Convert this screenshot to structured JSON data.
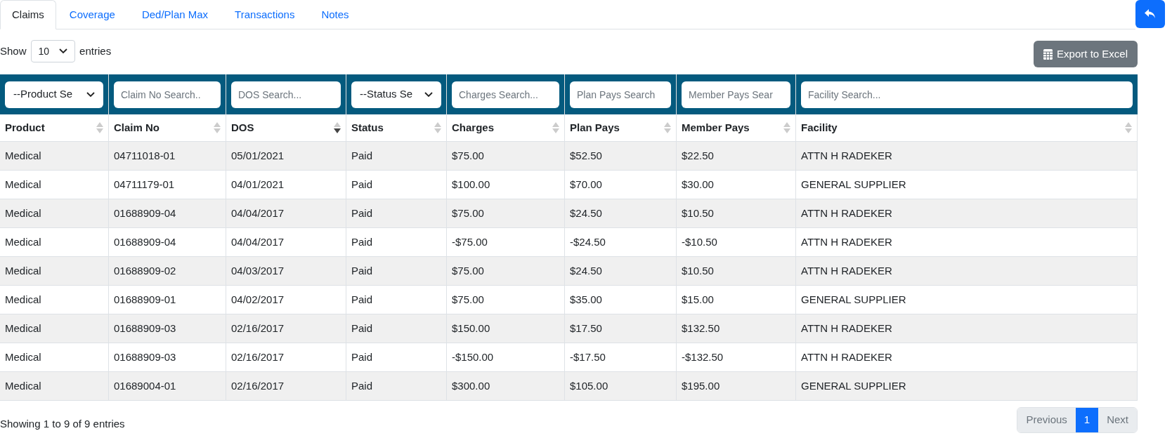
{
  "tabs": [
    {
      "label": "Claims",
      "selected": true
    },
    {
      "label": "Coverage",
      "selected": false
    },
    {
      "label": "Ded/Plan Max",
      "selected": false
    },
    {
      "label": "Transactions",
      "selected": false
    },
    {
      "label": "Notes",
      "selected": false
    }
  ],
  "length_control": {
    "prefix": "Show",
    "value": "10",
    "suffix": "entries"
  },
  "export_button": "Export to Excel",
  "filters": [
    {
      "kind": "select",
      "value": "--Product Se"
    },
    {
      "kind": "input",
      "placeholder": "Claim No Search.."
    },
    {
      "kind": "input",
      "placeholder": "DOS Search..."
    },
    {
      "kind": "select",
      "value": "--Status Se"
    },
    {
      "kind": "input",
      "placeholder": "Charges Search..."
    },
    {
      "kind": "input",
      "placeholder": "Plan Pays Search"
    },
    {
      "kind": "input",
      "placeholder": "Member Pays Sear"
    },
    {
      "kind": "input",
      "placeholder": "Facility Search..."
    }
  ],
  "columns": [
    {
      "label": "Product",
      "sorted": false
    },
    {
      "label": "Claim No",
      "sorted": false
    },
    {
      "label": "DOS",
      "sorted": true
    },
    {
      "label": "Status",
      "sorted": false
    },
    {
      "label": "Charges",
      "sorted": false
    },
    {
      "label": "Plan Pays",
      "sorted": false
    },
    {
      "label": "Member Pays",
      "sorted": false
    },
    {
      "label": "Facility",
      "sorted": false
    }
  ],
  "rows": [
    [
      "Medical",
      "04711018-01",
      "05/01/2021",
      "Paid",
      "$75.00",
      "$52.50",
      "$22.50",
      "ATTN H RADEKER"
    ],
    [
      "Medical",
      "04711179-01",
      "04/01/2021",
      "Paid",
      "$100.00",
      "$70.00",
      "$30.00",
      "GENERAL SUPPLIER"
    ],
    [
      "Medical",
      "01688909-04",
      "04/04/2017",
      "Paid",
      "$75.00",
      "$24.50",
      "$10.50",
      "ATTN H RADEKER"
    ],
    [
      "Medical",
      "01688909-04",
      "04/04/2017",
      "Paid",
      "-$75.00",
      "-$24.50",
      "-$10.50",
      "ATTN H RADEKER"
    ],
    [
      "Medical",
      "01688909-02",
      "04/03/2017",
      "Paid",
      "$75.00",
      "$24.50",
      "$10.50",
      "ATTN H RADEKER"
    ],
    [
      "Medical",
      "01688909-01",
      "04/02/2017",
      "Paid",
      "$75.00",
      "$35.00",
      "$15.00",
      "GENERAL SUPPLIER"
    ],
    [
      "Medical",
      "01688909-03",
      "02/16/2017",
      "Paid",
      "$150.00",
      "$17.50",
      "$132.50",
      "ATTN H RADEKER"
    ],
    [
      "Medical",
      "01688909-03",
      "02/16/2017",
      "Paid",
      "-$150.00",
      "-$17.50",
      "-$132.50",
      "ATTN H RADEKER"
    ],
    [
      "Medical",
      "01689004-01",
      "02/16/2017",
      "Paid",
      "$300.00",
      "$105.00",
      "$195.00",
      "GENERAL SUPPLIER"
    ]
  ],
  "info": "Showing 1 to 9 of 9 entries",
  "pagination": [
    {
      "label": "Previous",
      "selected": false
    },
    {
      "label": "1",
      "selected": true
    },
    {
      "label": "Next",
      "selected": false
    }
  ]
}
